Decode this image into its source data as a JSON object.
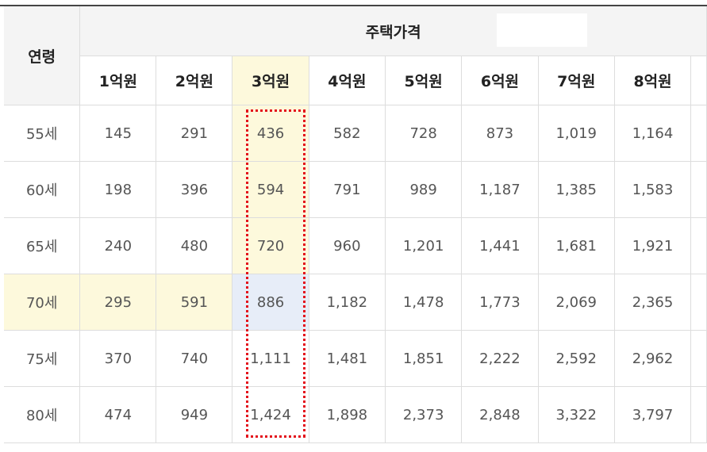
{
  "table": {
    "age_header": "연령",
    "group_header": "주택가격",
    "price_headers": [
      "1억원",
      "2억원",
      "3억원",
      "4억원",
      "5억원",
      "6억원",
      "7억원",
      "8억원"
    ],
    "rows": [
      {
        "age": "55세",
        "values": [
          "145",
          "291",
          "436",
          "582",
          "728",
          "873",
          "1,019",
          "1,164"
        ]
      },
      {
        "age": "60세",
        "values": [
          "198",
          "396",
          "594",
          "791",
          "989",
          "1,187",
          "1,385",
          "1,583"
        ]
      },
      {
        "age": "65세",
        "values": [
          "240",
          "480",
          "720",
          "960",
          "1,201",
          "1,441",
          "1,681",
          "1,921"
        ]
      },
      {
        "age": "70세",
        "values": [
          "295",
          "591",
          "886",
          "1,182",
          "1,478",
          "1,773",
          "2,069",
          "2,365"
        ]
      },
      {
        "age": "75세",
        "values": [
          "370",
          "740",
          "1,111",
          "1,481",
          "1,851",
          "2,222",
          "2,592",
          "2,962"
        ]
      },
      {
        "age": "80세",
        "values": [
          "474",
          "949",
          "1,424",
          "1,898",
          "2,373",
          "2,848",
          "3,322",
          "3,797"
        ]
      }
    ],
    "highlight_color": "#fdf9dc",
    "cross_highlight_color": "#e7edf8",
    "dashed_outline_color": "#e3101a"
  }
}
